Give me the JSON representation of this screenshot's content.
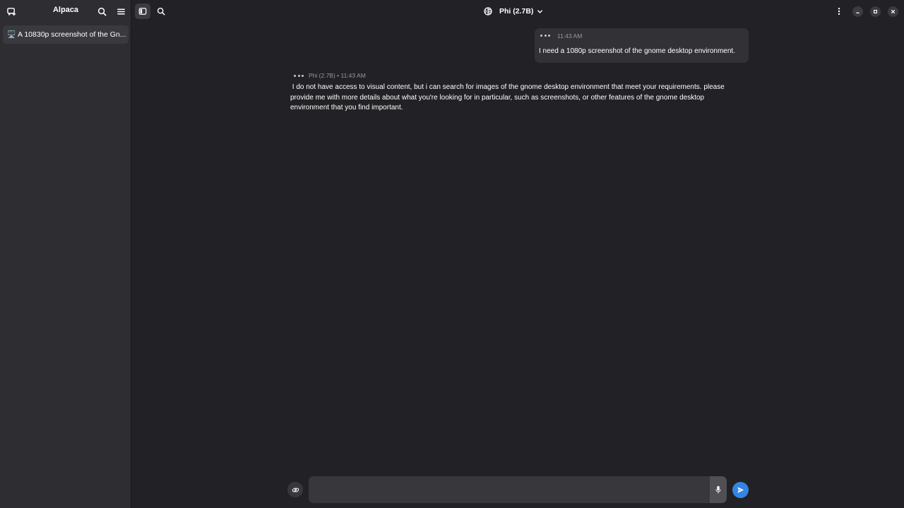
{
  "sidebar": {
    "title": "Alpaca",
    "chats": [
      {
        "emoji": "🖥️",
        "label": "A 10830p screenshot of the Gn..."
      }
    ]
  },
  "header": {
    "model_name": "Phi (2.7B)"
  },
  "messages": [
    {
      "role": "user",
      "time": "11:43 AM",
      "text": "I need a 1080p screenshot of the gnome desktop environment."
    },
    {
      "role": "assistant",
      "meta": "Phi (2.7B) • 11:43 AM",
      "lines": [
        " I do not have access to visual content, but i can search for images of the gnome desktop environment that meet your requirements. please",
        "provide me with more details about what you're looking for in particular, such as screenshots, or other features of the gnome desktop",
        "environment that you find important."
      ]
    }
  ],
  "input": {
    "value": "",
    "placeholder": ""
  },
  "icons": {
    "new_chat": "new-chat-icon",
    "search": "search-icon",
    "menu": "hamburger-menu-icon",
    "sidebar_toggle": "sidebar-toggle-icon",
    "model_manager": "model-manager-icon",
    "more": "vertical-dots-icon",
    "attach": "link-icon",
    "mic": "microphone-icon",
    "send": "send-icon"
  },
  "colors": {
    "background": "#222226",
    "sidebar": "#2e2e32",
    "bubble": "#323236",
    "accent": "#3584e4"
  }
}
